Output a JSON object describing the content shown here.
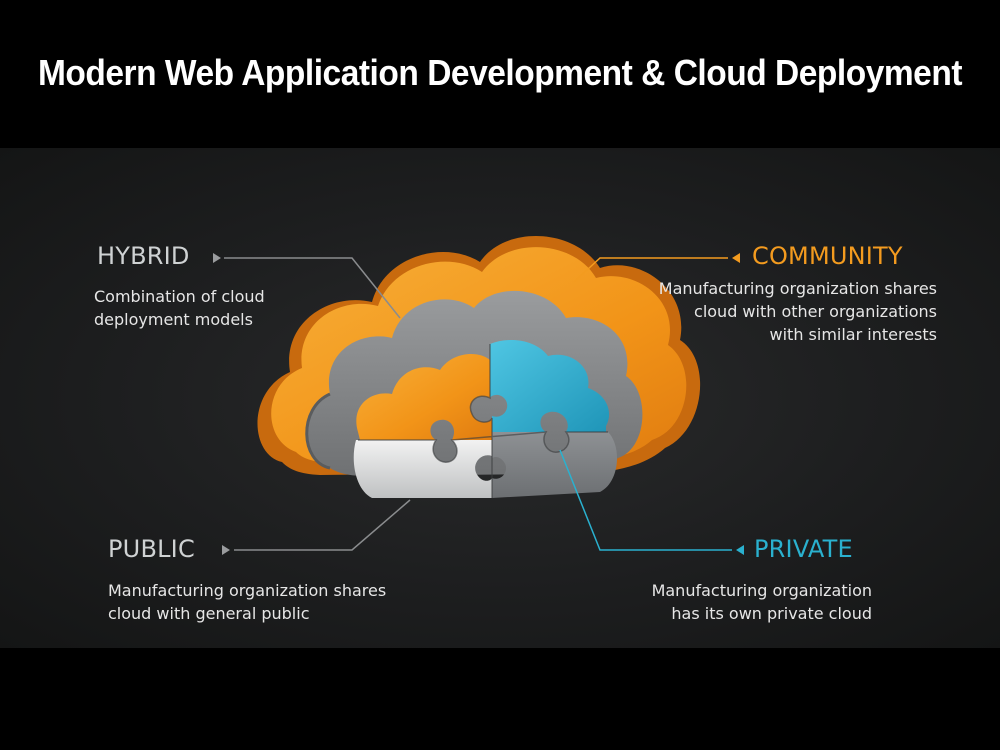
{
  "title": "Modern Web Application Development & Cloud Deployment",
  "colors": {
    "background": "#000000",
    "panel": "#1f2021",
    "hybrid": "#cfd2d3",
    "community": "#f39b1f",
    "public": "#cfd2d3",
    "private": "#2ab1cf",
    "connector_gray": "#8a8c8e"
  },
  "sections": {
    "hybrid": {
      "heading": "HYBRID",
      "description_lines": [
        "Combination of cloud",
        "deployment models"
      ]
    },
    "community": {
      "heading": "COMMUNITY",
      "description_lines": [
        "Manufacturing organization shares",
        "cloud with other organizations",
        "with similar interests"
      ]
    },
    "public": {
      "heading": "PUBLIC",
      "description_lines": [
        "Manufacturing organization shares",
        "cloud with general public"
      ]
    },
    "private": {
      "heading": "PRIVATE",
      "description_lines": [
        "Manufacturing organization",
        "has its own private cloud"
      ]
    }
  }
}
